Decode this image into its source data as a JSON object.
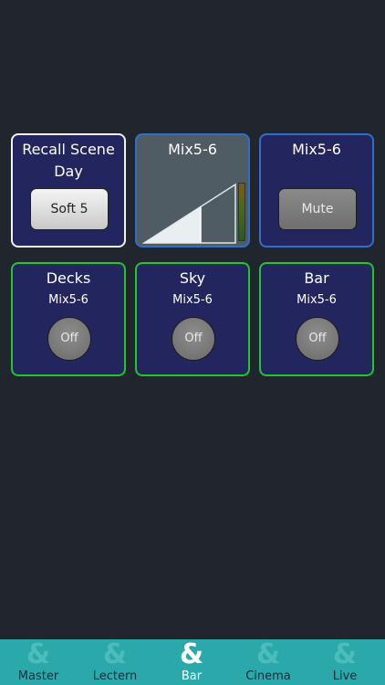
{
  "tiles": {
    "recall": {
      "title": "Recall Scene",
      "subtitle": "Day",
      "button": "Soft 5"
    },
    "fader": {
      "title": "Mix5-6",
      "level": 0.62
    },
    "mute": {
      "title": "Mix5-6",
      "button": "Mute"
    },
    "decks": {
      "title": "Decks",
      "subtitle": "Mix5-6",
      "button": "Off"
    },
    "sky": {
      "title": "Sky",
      "subtitle": "Mix5-6",
      "button": "Off"
    },
    "bar": {
      "title": "Bar",
      "subtitle": "Mix5-6",
      "button": "Off"
    }
  },
  "tabbar": {
    "glyph": "&",
    "items": [
      {
        "label": "Master"
      },
      {
        "label": "Lectern"
      },
      {
        "label": "Bar",
        "active": true
      },
      {
        "label": "Cinema"
      },
      {
        "label": "Live"
      }
    ]
  },
  "colors": {
    "background": "#21262e",
    "tile_fill": "#23265e",
    "border_blue": "#2f6fc9",
    "border_green": "#21c52e",
    "border_white": "#f2f2f2",
    "tabbar": "#2ba9aa"
  }
}
